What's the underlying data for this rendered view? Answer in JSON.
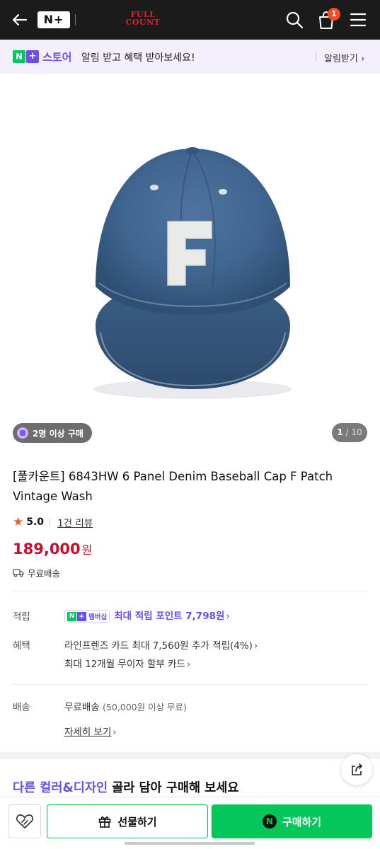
{
  "topbar": {
    "nplus_logo": "N+",
    "brand_line1": "FULL",
    "brand_line2": "COUNT",
    "cart_count": "1"
  },
  "notice": {
    "logo_n": "N",
    "logo_plus": "+",
    "logo_store": "스토어",
    "text": "알림 받고 혜택 받아보세요!",
    "action": "알림받기",
    "action_chevron": "›"
  },
  "gallery": {
    "buy_badge": "2명 이상 구매",
    "current": "1",
    "total": "/ 10",
    "patch_letter": "F"
  },
  "product": {
    "title": "[풀카운트] 6843HW 6 Panel Denim Baseball Cap F Patch Vintage Wash",
    "rating_star": "★",
    "rating": "5.0",
    "review_link": "1건 리뷰",
    "price": "189,000",
    "price_unit": "원",
    "shipping": "무료배송"
  },
  "details": {
    "points_label": "적립",
    "member_badge_n": "N",
    "member_badge_plus": "+",
    "member_badge_text": "멤버십",
    "points_text": "최대 적립 포인트 7,798원",
    "benefit_label": "혜택",
    "benefit_line1": "라인프렌즈 카드 최대 7,560원 추가 적립(4%)",
    "benefit_line2": "최대 12개월 무이자 할부 카드",
    "delivery_label": "배송",
    "delivery_main": "무료배송",
    "delivery_note": "(50,000원 이상 무료)",
    "delivery_more": "자세히 보기",
    "chevron": "›"
  },
  "promo": {
    "highlight": "다른 컬러&디자인",
    "rest": " 골라 담아 구매해 보세요"
  },
  "bottom": {
    "gift_label": "선물하기",
    "buy_icon": "N",
    "buy_label": "구매하기"
  },
  "colors": {
    "accent_purple": "#6b4ee6",
    "naver_green": "#03c75a",
    "price_red": "#c8102e",
    "star_orange": "#f15a24",
    "brand_red": "#d8262e"
  }
}
